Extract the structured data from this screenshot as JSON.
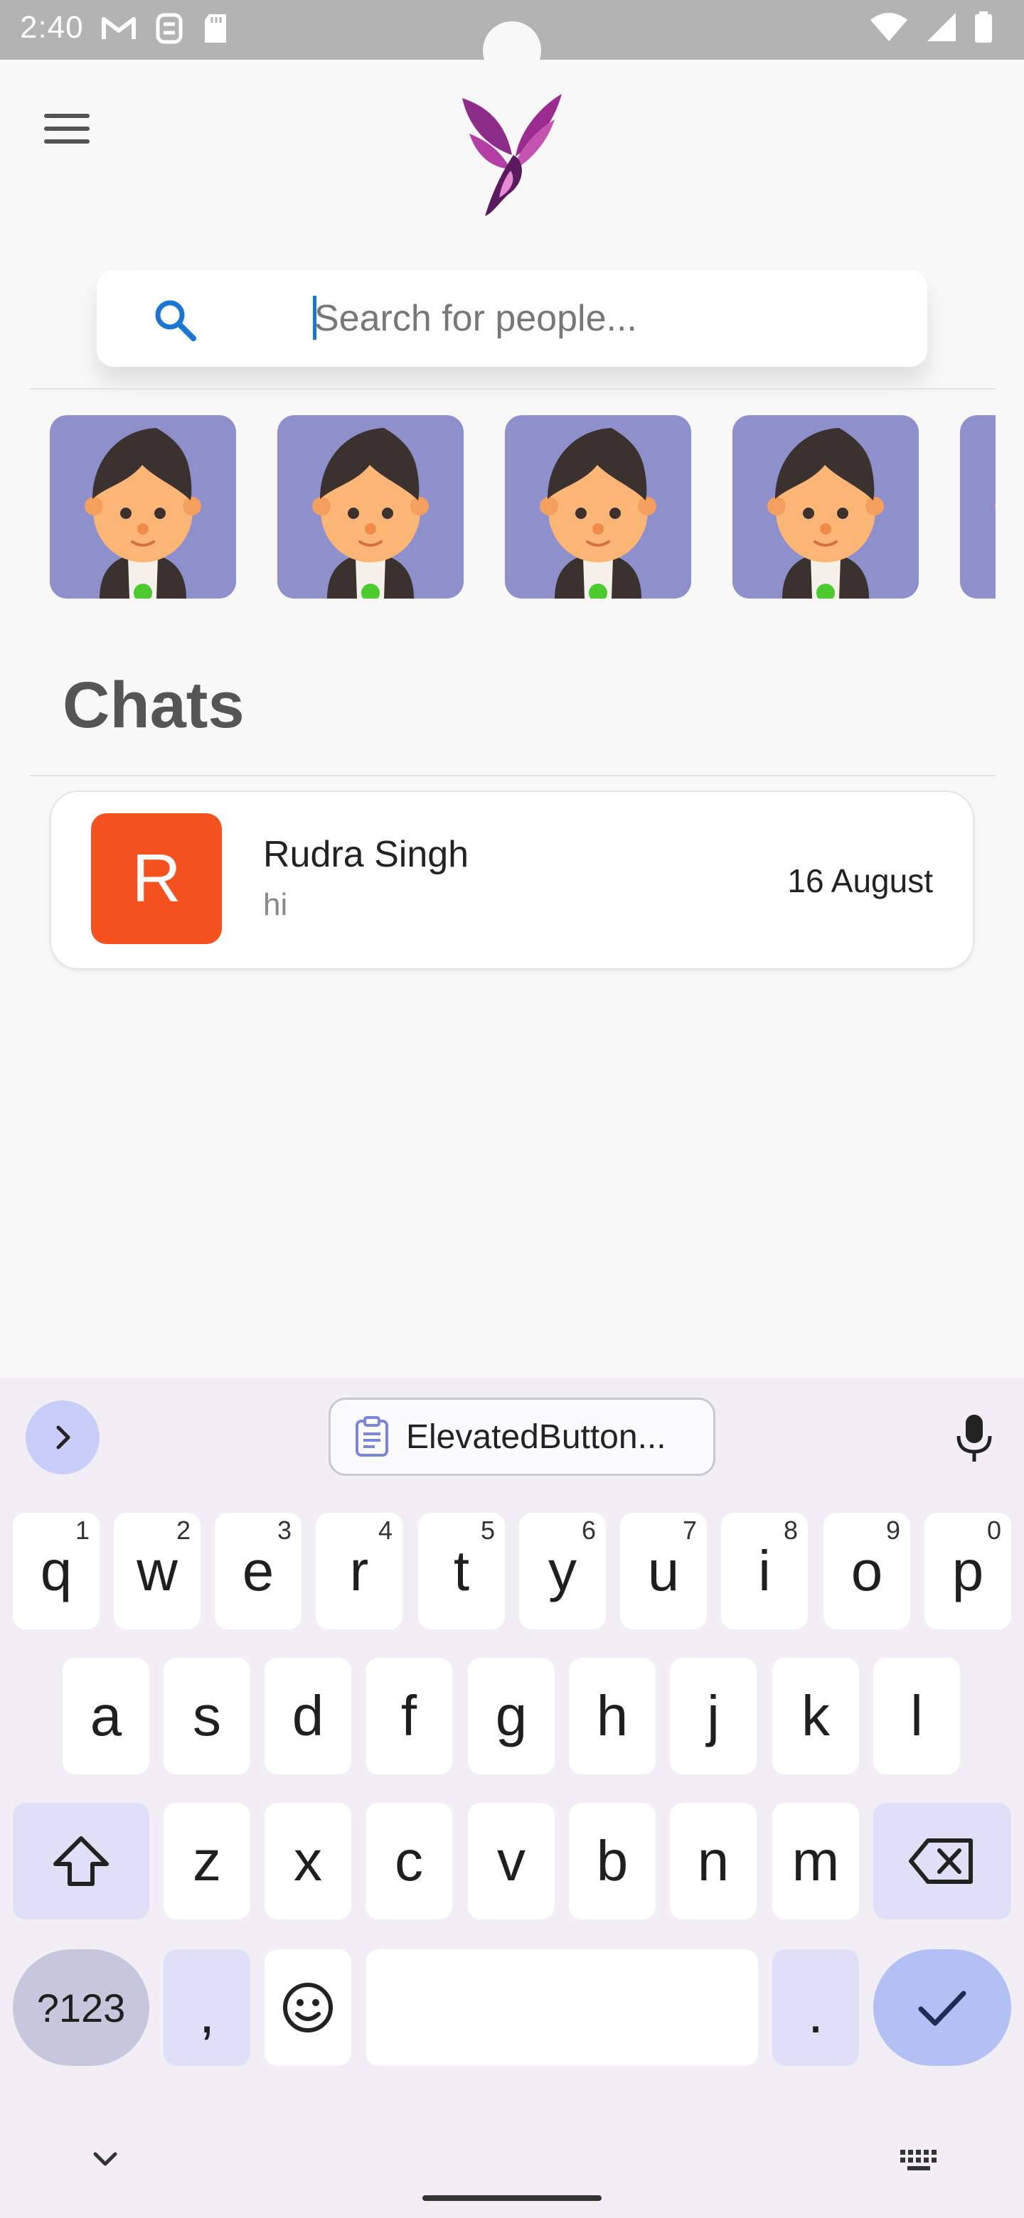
{
  "status_bar": {
    "time": "2:40",
    "left_icons": [
      "gmail-icon",
      "app-icon",
      "sd-card-icon"
    ],
    "right_icons": [
      "wifi-icon",
      "signal-icon",
      "battery-icon"
    ]
  },
  "app_bar": {
    "menu_icon": "menu-icon",
    "logo": "bird-logo"
  },
  "search": {
    "placeholder": "Search for people...",
    "value": ""
  },
  "avatars": {
    "items": [
      {
        "online": true
      },
      {
        "online": true
      },
      {
        "online": true
      },
      {
        "online": true
      },
      {
        "online": true
      }
    ]
  },
  "chats": {
    "title": "Chats",
    "items": [
      {
        "initial": "R",
        "name": "Rudra Singh",
        "preview": "hi",
        "date": "16 August",
        "avatar_color": "#f4511e"
      }
    ]
  },
  "keyboard": {
    "clipboard_suggestion": "ElevatedButton...",
    "row1": [
      {
        "key": "q",
        "hint": "1"
      },
      {
        "key": "w",
        "hint": "2"
      },
      {
        "key": "e",
        "hint": "3"
      },
      {
        "key": "r",
        "hint": "4"
      },
      {
        "key": "t",
        "hint": "5"
      },
      {
        "key": "y",
        "hint": "6"
      },
      {
        "key": "u",
        "hint": "7"
      },
      {
        "key": "i",
        "hint": "8"
      },
      {
        "key": "o",
        "hint": "9"
      },
      {
        "key": "p",
        "hint": "0"
      }
    ],
    "row2": [
      "a",
      "s",
      "d",
      "f",
      "g",
      "h",
      "j",
      "k",
      "l"
    ],
    "row3": [
      "z",
      "x",
      "c",
      "v",
      "b",
      "n",
      "m"
    ],
    "symbols_label": "?123",
    "comma": ",",
    "period": "."
  },
  "colors": {
    "status_bar": "#b3b3b3",
    "avatar_bg": "#8e90cb",
    "chat_avatar": "#f4511e",
    "accent_blue": "#1976d2",
    "online_dot": "#4caf50"
  }
}
